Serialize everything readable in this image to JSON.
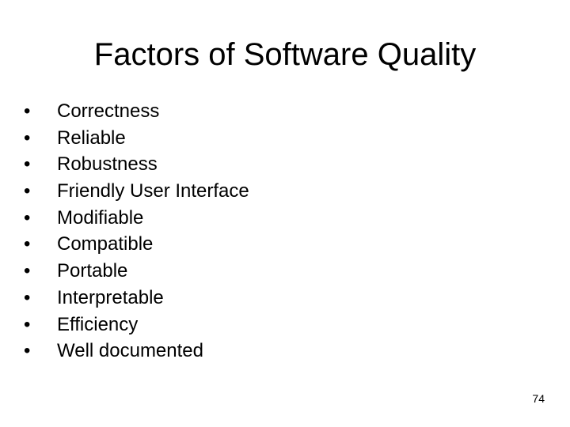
{
  "slide": {
    "title": "Factors of Software Quality",
    "bullet_glyph": "•",
    "bullets": [
      {
        "label": "Correctness"
      },
      {
        "label": "Reliable"
      },
      {
        "label": "Robustness"
      },
      {
        "label": "Friendly User Interface"
      },
      {
        "label": "Modifiable"
      },
      {
        "label": "Compatible"
      },
      {
        "label": "Portable"
      },
      {
        "label": "Interpretable"
      },
      {
        "label": "Efficiency"
      },
      {
        "label": "Well documented"
      }
    ],
    "page_number": "74"
  }
}
